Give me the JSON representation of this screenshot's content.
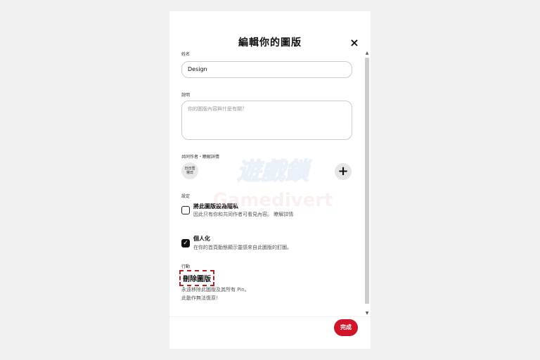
{
  "modal": {
    "title": "編輯你的圖版",
    "close_icon": "×"
  },
  "form": {
    "name_label": "姓名",
    "name_value": "Design",
    "description_label": "說明",
    "description_placeholder": "你的圖版內容與什麼有關？",
    "collaborators_label": "共同作者・瞭解詳情",
    "collaborator_avatar_text_1": "日日雪",
    "collaborator_avatar_text_2": "場日",
    "add_icon": "+",
    "settings_label": "設定",
    "secret_title": "將此圖版設為隱私",
    "secret_subtitle": "因此只有你和共同作者可看見內容。 瞭解詳情",
    "secret_checked": false,
    "personalize_title": "個人化",
    "personalize_subtitle": "在你的首頁動態顯示靈感來自此圖版的釘圖。",
    "personalize_checked": true,
    "check_icon": "✓",
    "actions_label": "行動",
    "delete_title": "刪除圖版",
    "delete_subtitle_1": "永遠移除此圖版及其所有 Pin。",
    "delete_subtitle_2": "此動作無法復原！"
  },
  "footer": {
    "done_label": "完成"
  },
  "scrollbar": {
    "up_icon": "▲",
    "down_icon": "▼"
  },
  "watermark": {
    "text_line1": "遊戲鎖",
    "text_line2": "Gamedivert"
  },
  "colors": {
    "accent": "#d0142a",
    "dashed_highlight": "#b42323"
  }
}
